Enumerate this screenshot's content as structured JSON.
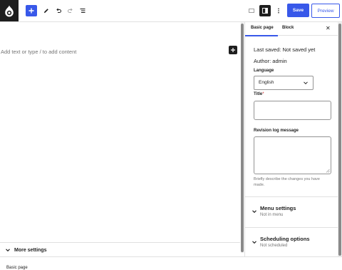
{
  "toolbar": {
    "save_label": "Save",
    "preview_label": "Preview"
  },
  "editor": {
    "placeholder": "Add text or type / to add content"
  },
  "more_settings": {
    "label": "More settings"
  },
  "footer": {
    "breadcrumb": "Basic page"
  },
  "sidebar": {
    "tabs": [
      {
        "label": "Basic page",
        "active": true
      },
      {
        "label": "Block",
        "active": false
      }
    ],
    "close_icon": "close-icon",
    "last_saved_label": "Last saved:",
    "last_saved_value": "Not saved yet",
    "author_label": "Author:",
    "author_value": "admin",
    "language_label": "Language",
    "language_value": "English",
    "title_label": "Title",
    "title_required": "*",
    "title_value": "",
    "revision_label": "Revision log message",
    "revision_value": "",
    "revision_help": "Briefly describe the changes you have made.",
    "panels": [
      {
        "title": "Menu settings",
        "subtitle": "Not in menu"
      },
      {
        "title": "Scheduling options",
        "subtitle": "Not scheduled"
      }
    ]
  },
  "colors": {
    "accent": "#3858e9",
    "dark": "#1e1e1e",
    "muted": "#757575",
    "border": "#e0e0e0"
  }
}
